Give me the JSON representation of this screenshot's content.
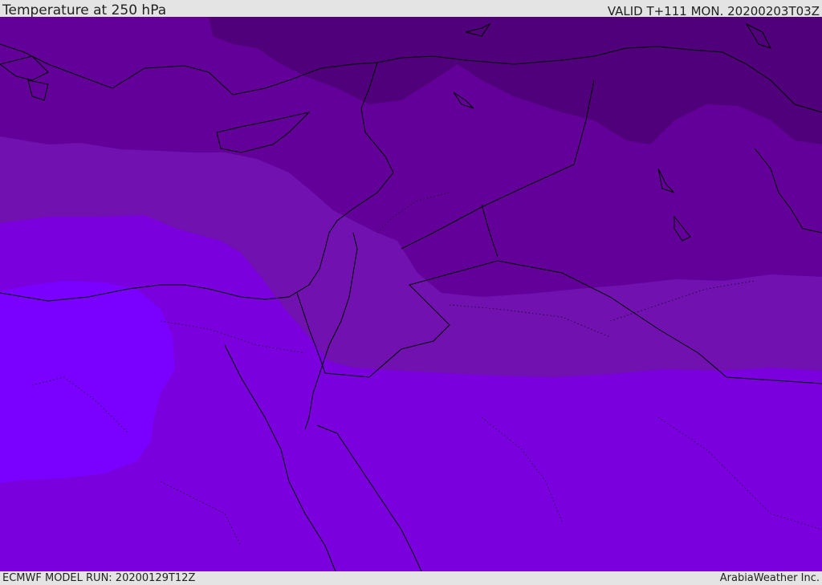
{
  "header": {
    "title": "Temperature at 250 hPa",
    "valid": "VALID T+111 MON. 20200203T03Z"
  },
  "footer": {
    "model_run": "ECMWF MODEL RUN: 20200129T12Z",
    "credit": "ArabiaWeather Inc."
  },
  "map": {
    "colors": {
      "band_darkest": "#4f007a",
      "band_dark": "#64009a",
      "band_mid": "#7011b0",
      "band_bright": "#7a00de",
      "band_brightest": "#7a00ff",
      "coastline": "#000000"
    }
  }
}
